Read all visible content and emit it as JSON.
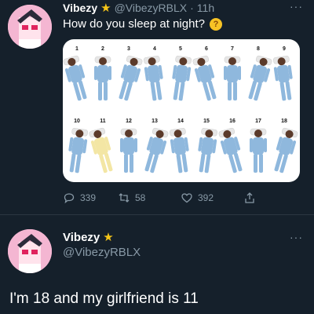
{
  "tweet": {
    "name": "Vibezy",
    "handle": "@VibezyRBLX",
    "separator": "·",
    "time": "11h",
    "text": "How do you sleep at night?",
    "emoji": "thinking-face",
    "more": "···",
    "positions": [
      "1",
      "2",
      "3",
      "4",
      "5",
      "6",
      "7",
      "8",
      "9",
      "10",
      "11",
      "12",
      "13",
      "14",
      "15",
      "16",
      "17",
      "18"
    ],
    "stats": {
      "replies": "339",
      "retweets": "58",
      "likes": "392"
    }
  },
  "reply": {
    "name": "Vibezy",
    "handle": "@VibezyRBLX",
    "more": "···",
    "text": "I'm 18 and my girlfriend is 11"
  },
  "colors": {
    "background": "#15202b",
    "text": "#ffffff",
    "muted": "#8899a6",
    "verified_star": "#f5c518",
    "figure_blue": "#8fb8dd",
    "figure_yellow": "#f3e6a4"
  }
}
